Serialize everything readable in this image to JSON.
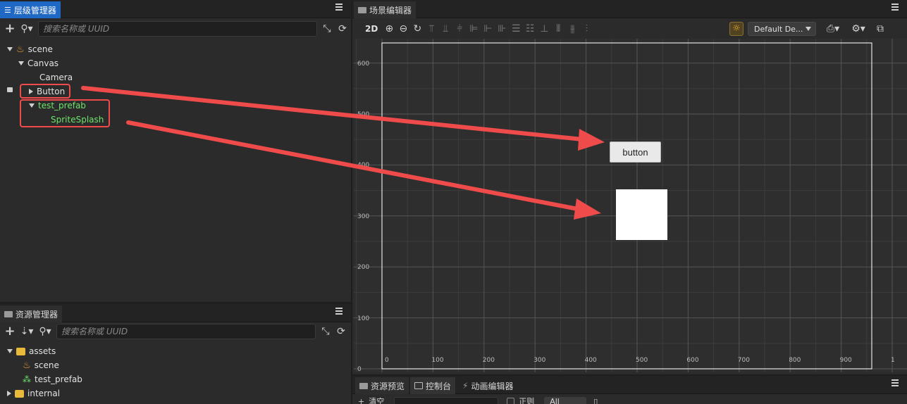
{
  "hierarchy": {
    "tab_label": "层级管理器",
    "search_placeholder": "搜索名称或 UUID",
    "nodes": [
      {
        "label": "scene"
      },
      {
        "label": "Canvas"
      },
      {
        "label": "Camera"
      },
      {
        "label": "Button"
      },
      {
        "label": "test_prefab"
      },
      {
        "label": "SpriteSplash"
      }
    ]
  },
  "assets": {
    "tab_label": "资源管理器",
    "search_placeholder": "搜索名称或 UUID",
    "items": [
      {
        "label": "assets"
      },
      {
        "label": "scene"
      },
      {
        "label": "test_prefab"
      },
      {
        "label": "internal"
      }
    ]
  },
  "scene_editor": {
    "tab_label": "场景编辑器",
    "mode_label": "2D",
    "design_dropdown": "Default De...",
    "y_ticks": [
      "600",
      "500",
      "400",
      "300",
      "200",
      "100",
      "0"
    ],
    "x_ticks": [
      "0",
      "100",
      "200",
      "300",
      "400",
      "500",
      "600",
      "700",
      "800",
      "900",
      "1"
    ],
    "button_label": "button"
  },
  "bottom": {
    "tabs": [
      "资源预览",
      "控制台",
      "动画编辑器"
    ],
    "clear_label": "清空",
    "regex_label": "正则",
    "level_select": "All"
  },
  "colors": {
    "accent_blue": "#1f68c4",
    "highlight_red": "#ef4b4b",
    "prefab_green": "#6ee36a"
  }
}
